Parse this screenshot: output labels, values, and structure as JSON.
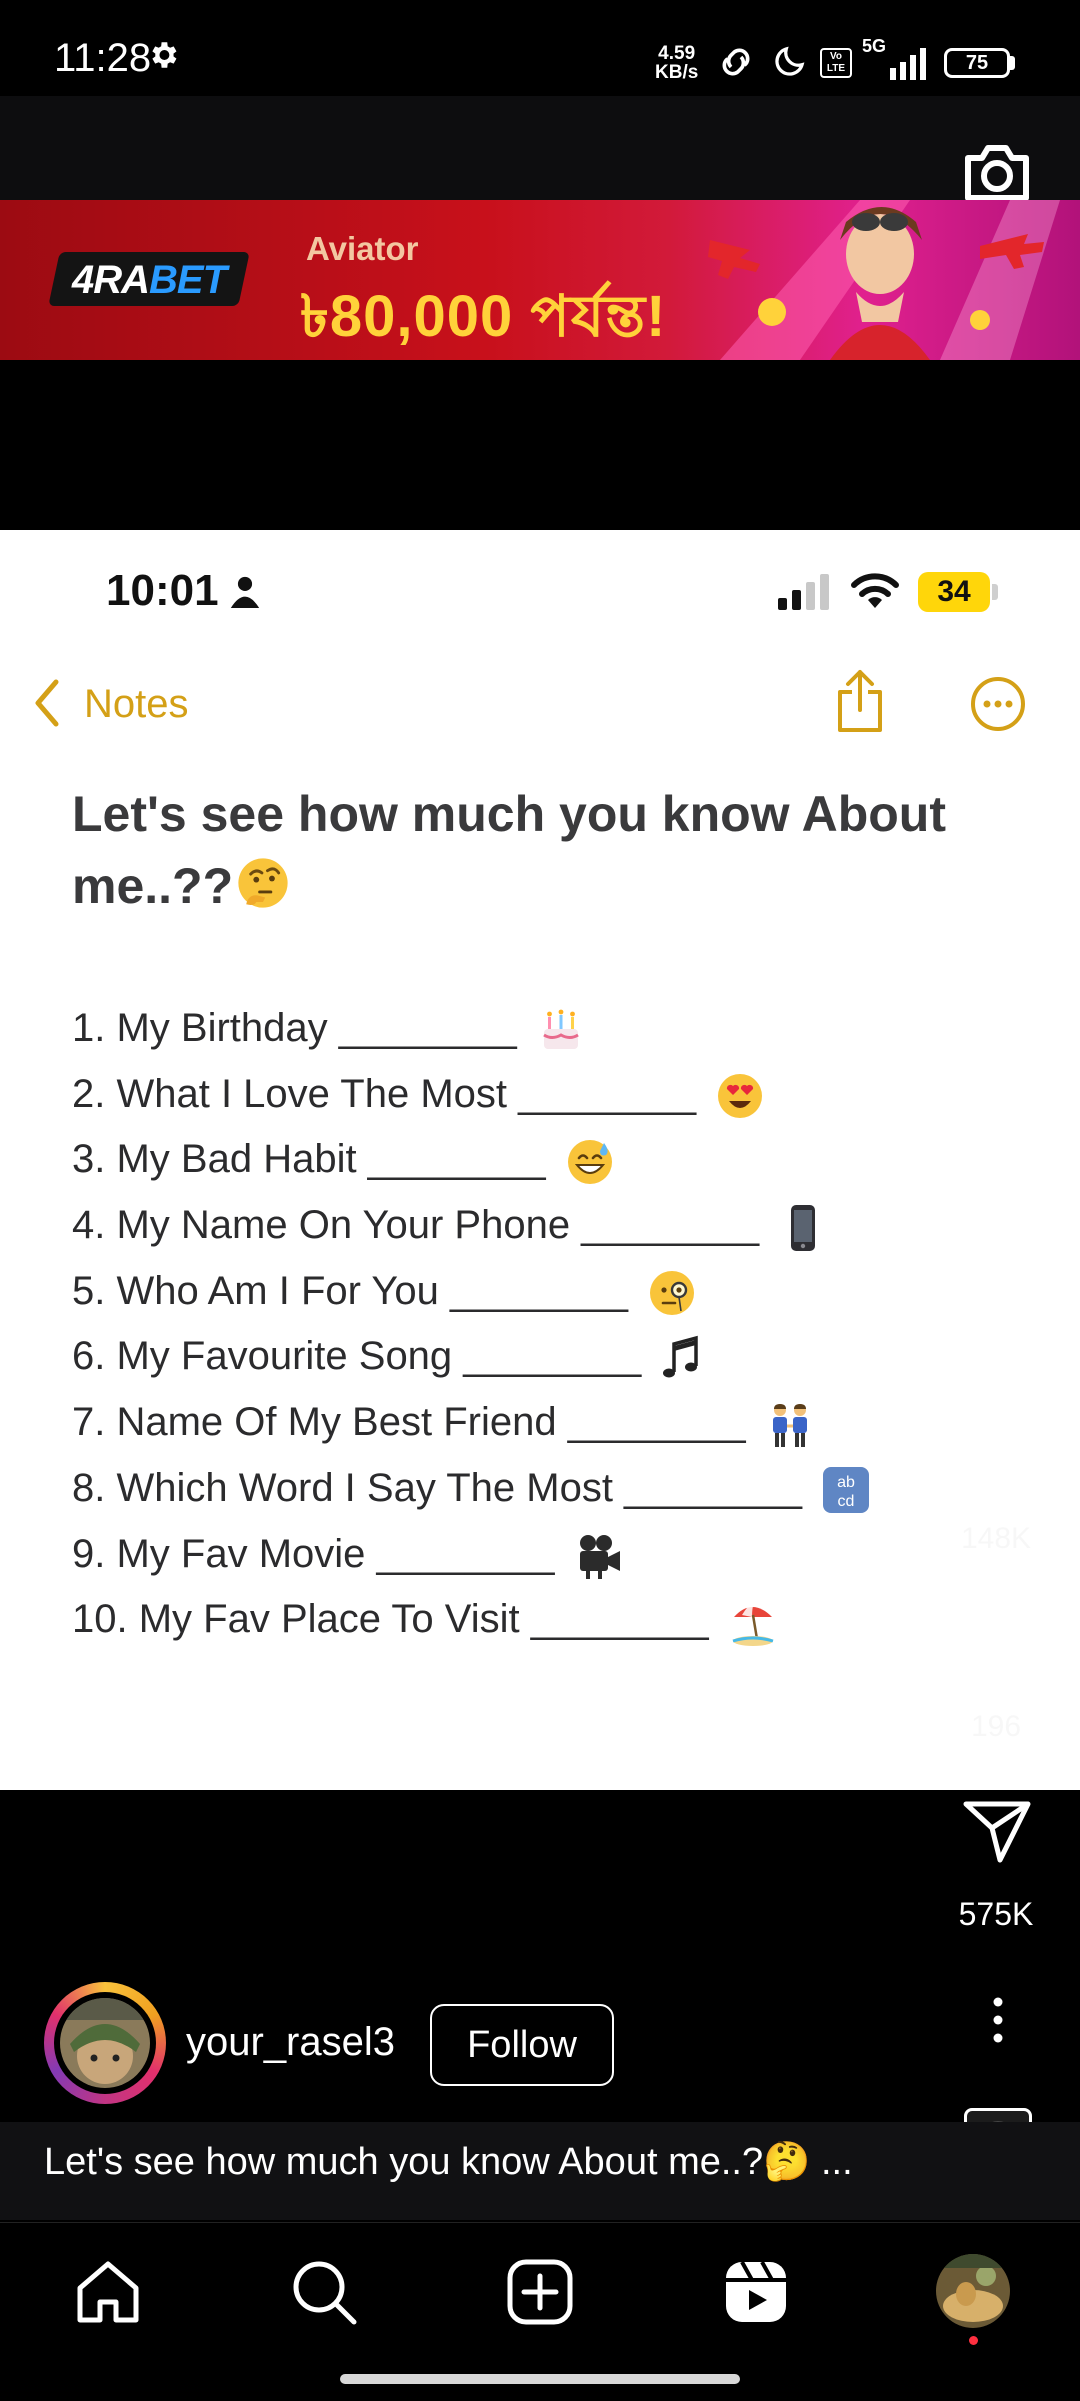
{
  "status_bar": {
    "time": "11:28",
    "net_speed_value": "4.59",
    "net_speed_unit": "KB/s",
    "volte": "Vo LTE",
    "network": "5G",
    "battery": "75"
  },
  "ad": {
    "brand_prefix": "4RA",
    "brand_suffix": "BET",
    "subtitle": "Aviator",
    "headline": "৳80,000 পর্যন্ত!"
  },
  "notes_screen": {
    "time": "10:01",
    "battery": "34",
    "back_label": "Notes",
    "title": "Let's see how much you know About me..??",
    "items": [
      {
        "text": "1. My Birthday ________",
        "emoji": "cake"
      },
      {
        "text": "2. What I Love The Most ________",
        "emoji": "heart-eyes"
      },
      {
        "text": "3. My Bad Habit ________",
        "emoji": "sweat-smile"
      },
      {
        "text": "4. My Name On Your Phone ________",
        "emoji": "mobile-phone"
      },
      {
        "text": "5. Who Am I For You ________",
        "emoji": "monocle-face"
      },
      {
        "text": "6. My Favourite Song ________",
        "emoji": "musical-notes"
      },
      {
        "text": "7. Name Of My Best Friend ________",
        "emoji": "two-men"
      },
      {
        "text": "8. Which Word I Say The Most ________",
        "emoji": "abcd-symbol"
      },
      {
        "text": "9. My Fav Movie ________",
        "emoji": "movie-camera"
      },
      {
        "text": "10. My Fav Place To Visit ________",
        "emoji": "beach-umbrella"
      }
    ]
  },
  "actions": {
    "likes": "148K",
    "comments": "196",
    "shares": "575K"
  },
  "author": {
    "username": "your_rasel3",
    "follow_label": "Follow"
  },
  "caption": "Let's see how much you know About me..?🤔 ...",
  "colors": {
    "notes_accent": "#d4a017",
    "ad_red": "#c8101b",
    "ad_gold": "#ffd23a",
    "live_dot": "#ff3040"
  }
}
